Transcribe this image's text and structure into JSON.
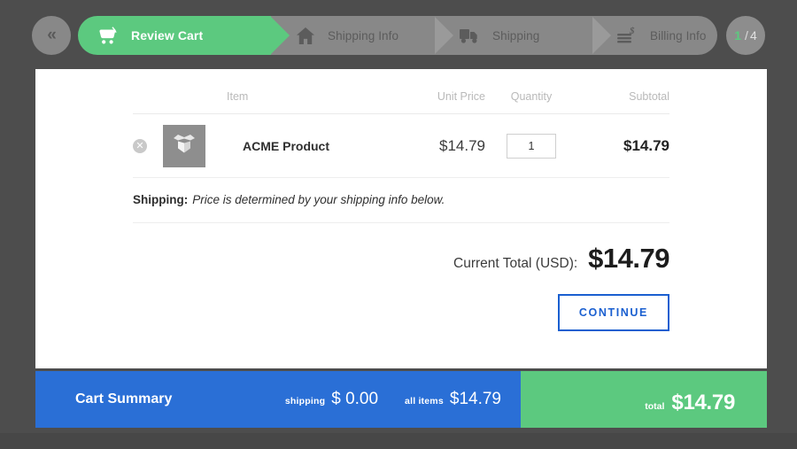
{
  "nav": {
    "back_icon": "double-chevron-left-icon",
    "steps": [
      {
        "label": "Review Cart",
        "icon": "shopping-cart-icon",
        "state": "active"
      },
      {
        "label": "Shipping Info",
        "icon": "home-icon",
        "state": "inactive"
      },
      {
        "label": "Shipping",
        "icon": "delivery-truck-icon",
        "state": "inactive"
      },
      {
        "label": "Billing Info",
        "icon": "invoice-dollar-icon",
        "state": "inactive"
      }
    ],
    "counter": {
      "current": "1",
      "separator": "/",
      "total": "4"
    }
  },
  "cart": {
    "columns": {
      "item": "Item",
      "unit_price": "Unit Price",
      "quantity": "Quantity",
      "subtotal": "Subtotal"
    },
    "rows": [
      {
        "remove_icon": "remove-circle-icon",
        "thumbnail_icon": "open-box-icon",
        "name": "ACME Product",
        "unit_price": "$14.79",
        "quantity": "1",
        "quantity_placeholder": "1",
        "subtotal": "$14.79"
      }
    ],
    "shipping_note": {
      "label": "Shipping:",
      "value": "Price is determined by your shipping info below."
    },
    "total": {
      "label": "Current Total (USD):",
      "value": "$14.79"
    },
    "continue_label": "CONTINUE"
  },
  "summary": {
    "title": "Cart Summary",
    "shipping_label": "shipping",
    "shipping_value": "$ 0.00",
    "all_items_label": "all items",
    "all_items_value": "$14.79",
    "total_label": "total",
    "total_value": "$14.79"
  },
  "colors": {
    "background": "#4d4d4d",
    "accent_green": "#5cc97f",
    "accent_blue": "#2a6fd6",
    "button_blue": "#1a5fd0",
    "step_inactive": "#888888"
  }
}
